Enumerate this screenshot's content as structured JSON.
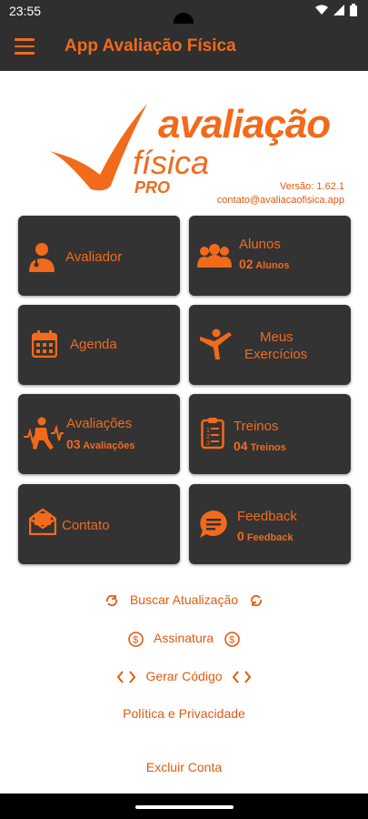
{
  "status_bar": {
    "time": "23:55"
  },
  "app_bar": {
    "title": "App Avaliação Física",
    "menu_icon": "hamburger-icon"
  },
  "logo": {
    "word1": "avaliação",
    "word2": "física",
    "word3": "PRO"
  },
  "meta": {
    "version": "Versão: 1.62.1",
    "contact": "contato@avaliacaofisica.app"
  },
  "cards": {
    "avaliador": {
      "label": "Avaliador"
    },
    "alunos": {
      "label": "Alunos",
      "count": "02",
      "unit": "Alunos"
    },
    "agenda": {
      "label": "Agenda"
    },
    "exercicios": {
      "line1": "Meus",
      "line2": "Exercícios"
    },
    "avaliacoes": {
      "label": "Avaliações",
      "count": "03",
      "unit": "Avaliações"
    },
    "treinos": {
      "label": "Treinos",
      "count": "04",
      "unit": "Treinos"
    },
    "contato": {
      "label": "Contato"
    },
    "feedback": {
      "label": "Feedback",
      "count": "0",
      "unit": "Feedback"
    }
  },
  "links": {
    "update": "Buscar Atualização",
    "subscription": "Assinatura",
    "code": "Gerar Código",
    "privacy": "Política e Privacidade",
    "delete": "Excluir Conta"
  },
  "colors": {
    "accent": "#f26a1b",
    "card_bg": "#333333",
    "bar_bg": "#2f2f2f"
  }
}
